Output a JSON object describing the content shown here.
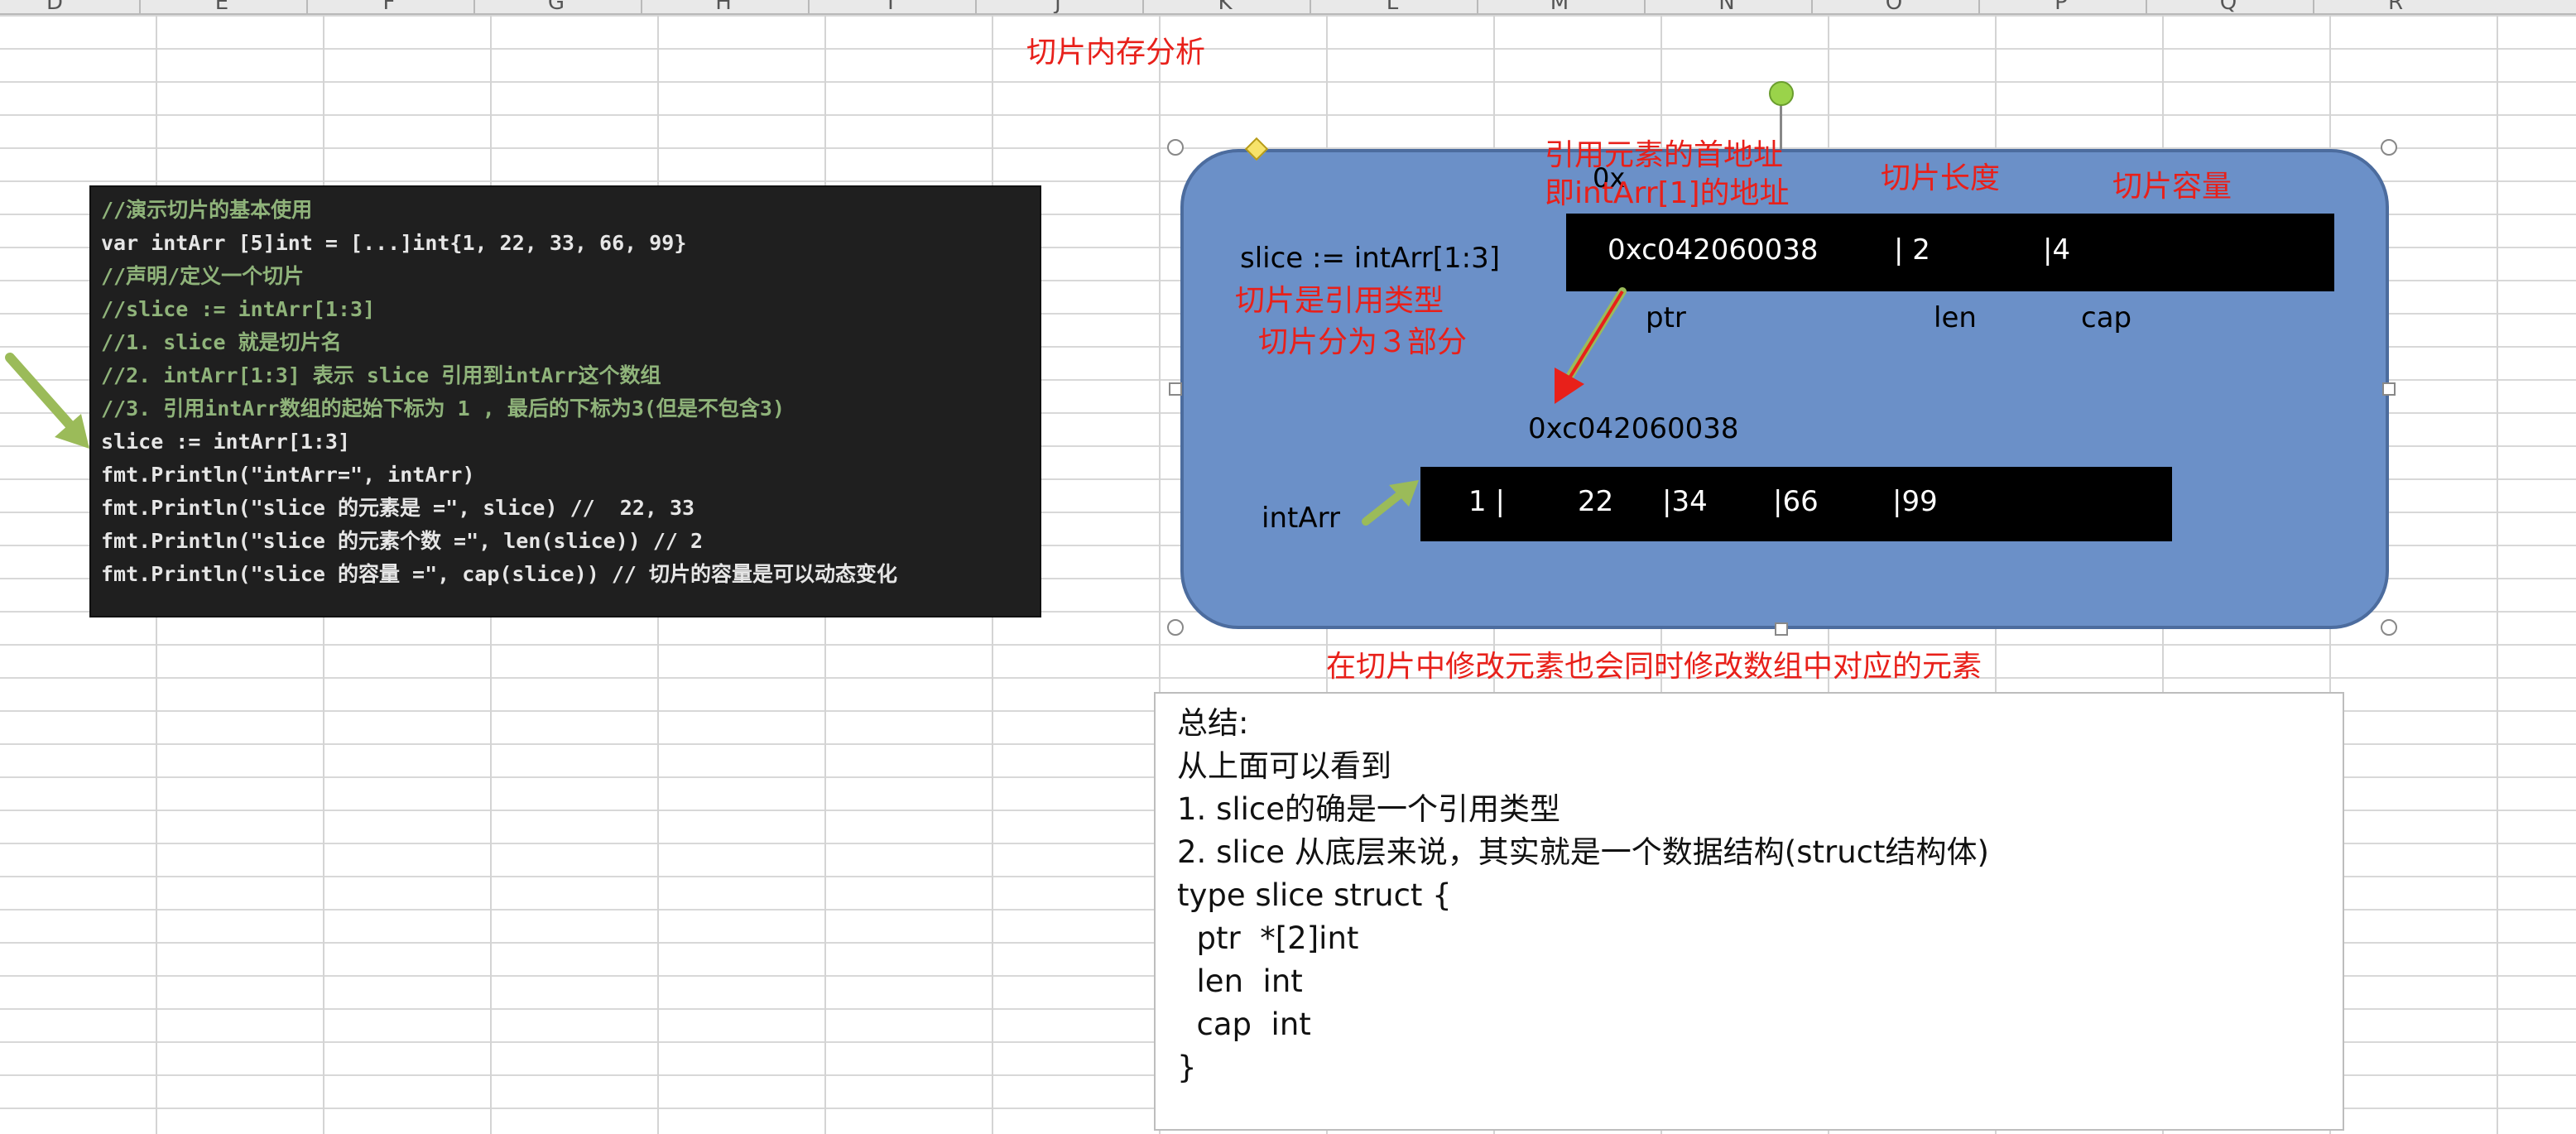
{
  "sheet": {
    "column_letters": [
      "D",
      "E",
      "F",
      "G",
      "H",
      "I",
      "J",
      "K",
      "L",
      "M",
      "N",
      "O",
      "P",
      "Q",
      "R"
    ]
  },
  "title": "切片内存分析",
  "code_lines": [
    {
      "text": "//演示切片的基本使用",
      "comment": true
    },
    {
      "text": "var intArr [5]int = [...]int{1, 22, 33, 66, 99}",
      "comment": false
    },
    {
      "text": "//声明/定义一个切片",
      "comment": true
    },
    {
      "text": "//slice := intArr[1:3]",
      "comment": true
    },
    {
      "text": "//1. slice 就是切片名",
      "comment": true
    },
    {
      "text": "//2. intArr[1:3] 表示 slice 引用到intArr这个数组",
      "comment": true
    },
    {
      "text": "//3. 引用intArr数组的起始下标为 1 , 最后的下标为3(但是不包含3)",
      "comment": true
    },
    {
      "text": "slice := intArr[1:3]",
      "comment": false
    },
    {
      "text": "fmt.Println(\"intArr=\", intArr)",
      "comment": false
    },
    {
      "text": "fmt.Println(\"slice 的元素是 =\", slice) //  22, 33",
      "comment": false
    },
    {
      "text": "fmt.Println(\"slice 的元素个数 =\", len(slice)) // 2",
      "comment": false
    },
    {
      "text": "fmt.Println(\"slice 的容量 =\", cap(slice)) // 切片的容量是可以动态变化",
      "comment": false
    }
  ],
  "diagram": {
    "ref_address_label_1": "引用元素的首地址",
    "ref_address_label_2": "即intArr[1]的地址",
    "partial_hex": "0x",
    "slice_length_label": "切片长度",
    "slice_capacity_label": "切片容量",
    "slice_decl": "slice := intArr[1:3]",
    "slice_is_ref": "切片是引用类型",
    "slice_three_parts": "切片分为３部分",
    "slice_struct": {
      "ptr": "0xc042060038",
      "len": "| 2",
      "cap": "|4"
    },
    "field_labels": {
      "ptr": "ptr",
      "len": "len",
      "cap": "cap"
    },
    "array_address": "0xc042060038",
    "array_name": "intArr",
    "array_cells": [
      "1 |",
      "22",
      "|34",
      "|66",
      "|99"
    ],
    "modify_note": "在切片中修改元素也会同时修改数组中对应的元素"
  },
  "summary": {
    "lines": [
      "总结:",
      "从上面可以看到",
      "1. slice的确是一个引用类型",
      "2. slice 从底层来说，其实就是一个数据结构(struct结构体)",
      "type slice struct {",
      "  ptr  *[2]int",
      "  len  int",
      "  cap  int",
      "}"
    ]
  },
  "colors": {
    "shape_fill": "#6b90c8",
    "annotation_red": "#e8201a",
    "arrow_green": "#9bbb59",
    "code_background": "#1f1f1f"
  }
}
